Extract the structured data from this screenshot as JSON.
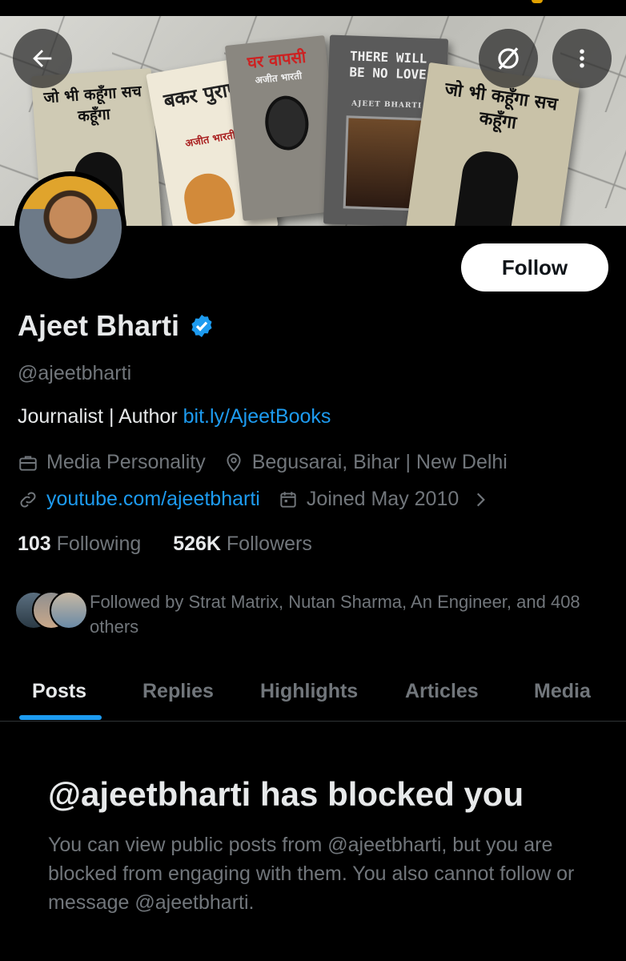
{
  "profile": {
    "name": "Ajeet Bharti",
    "handle": "@ajeetbharti",
    "bio_text": "Journalist | Author ",
    "bio_link": "bit.ly/AjeetBooks",
    "category": "Media Personality",
    "location": "Begusarai, Bihar | New Delhi",
    "website": "youtube.com/ajeetbharti",
    "joined": "Joined May 2010",
    "following_count": "103",
    "following_label": " Following",
    "followers_count": "526K",
    "followers_label": " Followers",
    "followed_by": "Followed by Strat Matrix, Nutan Sharma, An Engineer, and 408 others",
    "verified_color": "#1d9bf0"
  },
  "banner": {
    "book1_title": "जो भी कहूँगा सच कहूँगा",
    "book2_title": "बकर पुराण",
    "book2_author": "अजीत भारती",
    "book3_title": "घर वापसी",
    "book3_author": "अजीत भारती",
    "book4_title": "THERE WILL BE NO LOVE",
    "book4_author": "AJEET BHARTI",
    "book5_title": "जो भी कहूँगा सच कहूँगा"
  },
  "actions": {
    "follow_label": "Follow",
    "back_icon": "back-arrow-icon",
    "grok_icon": "grok-icon",
    "more_icon": "more-vertical-icon"
  },
  "tabs": [
    {
      "label": "Posts",
      "active": true
    },
    {
      "label": "Replies"
    },
    {
      "label": "Highlights"
    },
    {
      "label": "Articles"
    },
    {
      "label": "Media"
    }
  ],
  "blocked": {
    "title": "@ajeetbharti has blocked you",
    "message": "You can view public posts from @ajeetbharti, but you are blocked from engaging with them. You also cannot follow or message @ajeetbharti."
  },
  "colors": {
    "accent": "#1d9bf0",
    "background": "#000000",
    "text_primary": "#e7e9ea",
    "text_secondary": "#71767b"
  }
}
